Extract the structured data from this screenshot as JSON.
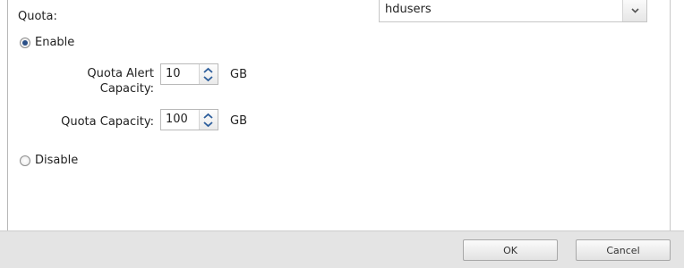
{
  "quota": {
    "label": "Quota:",
    "group_select_value": "hdusers",
    "enable_label": "Enable",
    "disable_label": "Disable",
    "selected": "enable",
    "alert_capacity_label_line1": "Quota Alert",
    "alert_capacity_label_line2": "Capacity:",
    "alert_capacity_value": "10",
    "alert_capacity_unit": "GB",
    "capacity_label": "Quota Capacity:",
    "capacity_value": "100",
    "capacity_unit": "GB"
  },
  "footer": {
    "ok_label": "OK",
    "cancel_label": "Cancel"
  },
  "icons": {
    "dropdown": "chevron-down-icon",
    "spinner": "spinner-arrows-icon"
  }
}
